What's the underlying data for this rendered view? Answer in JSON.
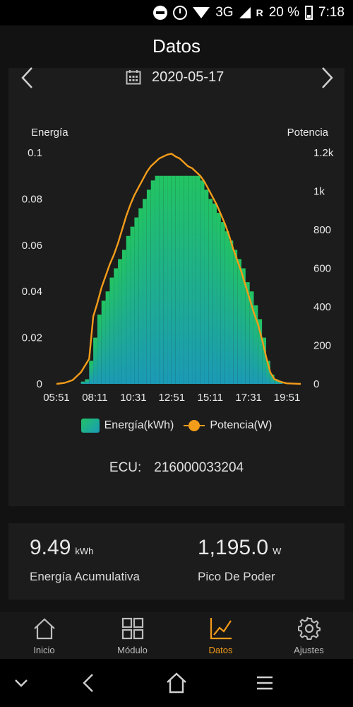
{
  "status_bar": {
    "network": "3G",
    "roaming": "R",
    "battery": "20 %",
    "time": "7:18",
    "icons": [
      "dnd-icon",
      "alarm-icon",
      "wifi-icon",
      "signal-icon",
      "battery-icon"
    ]
  },
  "header": {
    "title": "Datos"
  },
  "date_nav": {
    "date": "2020-05-17",
    "icons": [
      "chevron-left-icon",
      "calendar-icon",
      "chevron-right-icon"
    ]
  },
  "chart_data": {
    "type": "bar",
    "combo_line": true,
    "left_axis_title": "Energía",
    "right_axis_title": "Potencia",
    "left_ylim": [
      0,
      0.1
    ],
    "right_ylim": [
      0,
      1200
    ],
    "left_ticks": [
      "0",
      "0.02",
      "0.04",
      "0.06",
      "0.08",
      "0.1"
    ],
    "right_ticks": [
      "0",
      "200",
      "400",
      "600",
      "800",
      "1k",
      "1.2k"
    ],
    "x_ticks": [
      "05:51",
      "08:11",
      "10:31",
      "12:51",
      "15:11",
      "17:31",
      "19:51"
    ],
    "x_range": [
      "05:51",
      "20:41"
    ],
    "grid": false,
    "bar_colors": [
      "#21c267",
      "#1a9cb8"
    ],
    "line_color": "#f39c1a",
    "series": [
      {
        "name": "Energía(kWh)",
        "unit": "kWh",
        "x": [
          "05:51",
          "06:05",
          "06:20",
          "06:35",
          "06:50",
          "07:05",
          "07:20",
          "07:35",
          "07:50",
          "08:05",
          "08:20",
          "08:35",
          "08:50",
          "09:05",
          "09:20",
          "09:35",
          "09:50",
          "10:05",
          "10:20",
          "10:35",
          "10:50",
          "11:05",
          "11:20",
          "11:35",
          "11:50",
          "12:05",
          "12:20",
          "12:35",
          "12:50",
          "13:05",
          "13:20",
          "13:35",
          "13:50",
          "14:05",
          "14:20",
          "14:35",
          "14:50",
          "15:05",
          "15:20",
          "15:35",
          "15:50",
          "16:05",
          "16:20",
          "16:35",
          "16:50",
          "17:05",
          "17:20",
          "17:35",
          "17:50",
          "18:05",
          "18:20",
          "18:35",
          "18:50",
          "19:05",
          "19:20",
          "19:35",
          "19:50",
          "20:05",
          "20:20",
          "20:35"
        ],
        "values": [
          0,
          0,
          0,
          0,
          0,
          0,
          0.001,
          0.002,
          0.01,
          0.02,
          0.03,
          0.036,
          0.04,
          0.046,
          0.05,
          0.054,
          0.058,
          0.064,
          0.068,
          0.072,
          0.076,
          0.08,
          0.084,
          0.088,
          0.09,
          0.09,
          0.09,
          0.09,
          0.09,
          0.09,
          0.09,
          0.09,
          0.09,
          0.09,
          0.09,
          0.088,
          0.084,
          0.08,
          0.078,
          0.074,
          0.07,
          0.066,
          0.062,
          0.058,
          0.054,
          0.05,
          0.044,
          0.04,
          0.034,
          0.028,
          0.02,
          0.01,
          0.004,
          0.002,
          0.001,
          0,
          0,
          0,
          0,
          0
        ]
      },
      {
        "name": "Potencia(W)",
        "unit": "W",
        "x": [
          "05:51",
          "06:20",
          "06:50",
          "07:20",
          "07:50",
          "08:05",
          "08:20",
          "08:35",
          "08:50",
          "09:05",
          "09:20",
          "09:35",
          "09:50",
          "10:05",
          "10:20",
          "10:35",
          "10:50",
          "11:05",
          "11:20",
          "11:35",
          "11:50",
          "12:05",
          "12:20",
          "12:35",
          "12:50",
          "13:05",
          "13:20",
          "13:35",
          "13:50",
          "14:05",
          "14:20",
          "14:35",
          "14:50",
          "15:05",
          "15:20",
          "15:35",
          "15:50",
          "16:05",
          "16:20",
          "16:35",
          "16:50",
          "17:05",
          "17:20",
          "17:35",
          "17:50",
          "18:05",
          "18:20",
          "18:35",
          "18:50",
          "19:05",
          "19:20",
          "19:35",
          "19:50",
          "20:20",
          "20:41"
        ],
        "values": [
          0,
          5,
          20,
          60,
          130,
          350,
          420,
          500,
          560,
          620,
          670,
          730,
          800,
          870,
          930,
          980,
          1020,
          1060,
          1100,
          1130,
          1150,
          1170,
          1180,
          1190,
          1195,
          1180,
          1170,
          1150,
          1130,
          1120,
          1100,
          1080,
          1050,
          1010,
          970,
          930,
          880,
          830,
          770,
          700,
          640,
          580,
          510,
          440,
          370,
          310,
          230,
          140,
          60,
          25,
          15,
          8,
          3,
          1,
          0
        ]
      }
    ]
  },
  "legend": {
    "energy_label": "Energía(kWh)",
    "power_label": "Potencia(W)"
  },
  "ecu": {
    "label": "ECU:",
    "value": "216000033204"
  },
  "stats": {
    "energy_value": "9.49",
    "energy_unit": "kWh",
    "energy_label": "Energía Acumulativa",
    "peak_value": "1,195.0",
    "peak_unit": "W",
    "peak_label": "Pico De Poder"
  },
  "tabs": [
    {
      "label": "Inicio",
      "icon": "home-icon"
    },
    {
      "label": "Módulo",
      "icon": "grid-icon"
    },
    {
      "label": "Datos",
      "icon": "chart-icon",
      "active": true
    },
    {
      "label": "Ajustes",
      "icon": "gear-icon"
    }
  ],
  "colors": {
    "accent": "#f39c1a",
    "background": "#121212",
    "card": "#1c1c1c"
  }
}
